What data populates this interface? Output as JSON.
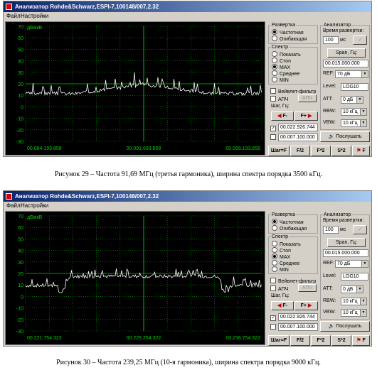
{
  "windows": [
    {
      "title": "Анализатор Rohde&Schwarz,ESPI-7,100148/007,2.32",
      "menu": [
        "Файл",
        "Настройки"
      ],
      "y_unit": "дБмкВ",
      "y_ticks": [
        "70",
        "60",
        "50",
        "40",
        "30",
        "20",
        "10",
        "0",
        "-10",
        "-20",
        "-30"
      ],
      "x_labels": [
        "00.084.193.858",
        "00.091.693.858",
        "00.099.193.858"
      ],
      "trace_profile": "narrow",
      "sweep": {
        "label": "Развертка",
        "opt1": "Частотная",
        "opt2": "Огибающая"
      },
      "spectrum": {
        "label": "Спектр",
        "opts": [
          "Показать",
          "Стоп",
          "MAX",
          "Среднее",
          "MIN"
        ]
      },
      "wavelet_label": "Вейвлет-фильтр",
      "afc_label": "АПЧ",
      "afc_btn": "АПЧ",
      "step_label": "Шаг, Гц:",
      "f_minus": "F-",
      "f_plus": "F+",
      "step1": "00.022.926.744",
      "step2": "00.007.100.000",
      "analyzer": {
        "label": "Анализатор",
        "sweep_time_label": "Время развертки:",
        "sweep_time": "100",
        "ms": "мс",
        "span_btn": "Span, Гц:",
        "span": "00.015.000.000",
        "ref_label": "REF:",
        "ref": "70 дБ",
        "level_label": "Level:",
        "level": "LOG10",
        "att_label": "ATT:",
        "att": "0 дБ",
        "rbw_label": "RBW:",
        "rbw": "10 кГц",
        "vbw_label": "VBW:",
        "vbw": "10 кГц",
        "listen": "Послушать"
      },
      "bottom_buttons": [
        "Шаг=F",
        "F/2",
        "F*2",
        "S*2",
        "F"
      ]
    },
    {
      "title": "Анализатор Rohde&Schwarz,ESPI-7,100148/007,2.32",
      "menu": [
        "Файл",
        "Настройки"
      ],
      "y_unit": "дБмкВ",
      "y_ticks": [
        "70",
        "60",
        "50",
        "40",
        "30",
        "20",
        "10",
        "0",
        "-10",
        "-20",
        "-30"
      ],
      "x_labels": [
        "00.221.754.322",
        "00.229.254.322",
        "00.236.754.322"
      ],
      "trace_profile": "wide",
      "sweep": {
        "label": "Развертка",
        "opt1": "Частотная",
        "opt2": "Огибающая"
      },
      "spectrum": {
        "label": "Спектр",
        "opts": [
          "Показать",
          "Стоп",
          "MAX",
          "Среднее",
          "MIN"
        ]
      },
      "wavelet_label": "Вейвлет-фильтр",
      "afc_label": "АПЧ",
      "afc_btn": "АПЧ",
      "step_label": "Шаг, Гц:",
      "f_minus": "F-",
      "f_plus": "F+",
      "step1": "00.022.926.744",
      "step2": "00.007.100.000",
      "analyzer": {
        "label": "Анализатор",
        "sweep_time_label": "Время развертки:",
        "sweep_time": "100",
        "ms": "мс",
        "span_btn": "Span, Гц:",
        "span": "00.015.000.000",
        "ref_label": "REF:",
        "ref": "70 дБ",
        "level_label": "Level:",
        "level": "LOG10",
        "att_label": "ATT:",
        "att": "0 дБ",
        "rbw_label": "RBW:",
        "rbw": "10 кГц",
        "vbw_label": "VBW:",
        "vbw": "10 кГц",
        "listen": "Послушать"
      },
      "bottom_buttons": [
        "Шаг=F",
        "F/2",
        "F*2",
        "S*2",
        "F"
      ]
    }
  ],
  "captions": [
    "Рисунок 29 – Частота 91,69 МГц (третья гармоника), ширина спектра порядка 3500 кГц.",
    "Рисунок 30 – Частота 239,25 МГц (10-я гармоника), ширина спектра порядка 9000 кГц."
  ],
  "colors": {
    "grid": "#00a000",
    "trace": "#ffffff",
    "axis_text": "#00d000",
    "title_bar": "#0a246a"
  }
}
